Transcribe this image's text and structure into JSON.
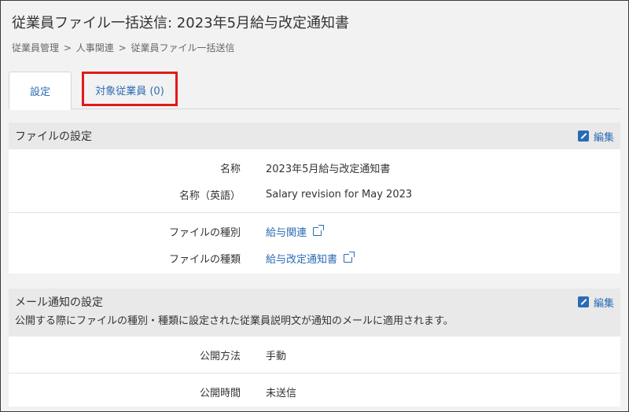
{
  "page": {
    "title": "従業員ファイル一括送信: 2023年5月給与改定通知書",
    "breadcrumb": [
      "従業員管理",
      ">",
      "人事関連",
      ">",
      "従業員ファイル一括送信"
    ]
  },
  "tabs": [
    {
      "label": "設定",
      "active": true
    },
    {
      "label": "対象従業員 (0)",
      "active": false
    }
  ],
  "file_settings": {
    "heading": "ファイルの設定",
    "edit_label": "編集",
    "rows_group1": [
      {
        "label": "名称",
        "value": "2023年5月給与改定通知書"
      },
      {
        "label": "名称（英語）",
        "value": "Salary revision for May 2023"
      }
    ],
    "rows_group2": [
      {
        "label": "ファイルの種別",
        "value": "給与関連"
      },
      {
        "label": "ファイルの種類",
        "value": "給与改定通知書"
      }
    ]
  },
  "mail_settings": {
    "heading": "メール通知の設定",
    "edit_label": "編集",
    "note": "公開する際にファイルの種別・種類に設定された従業員説明文が通知のメールに適用されます。",
    "rows_group1": [
      {
        "label": "公開方法",
        "value": "手動"
      }
    ],
    "rows_group2": [
      {
        "label": "公開時間",
        "value": "未送信"
      }
    ]
  },
  "colors": {
    "accent": "#2a6bb5",
    "highlight": "#e01b1b",
    "section_bg": "#e9e9e9"
  },
  "icons": {
    "edit": "pencil-square-icon",
    "external": "external-link-icon"
  }
}
